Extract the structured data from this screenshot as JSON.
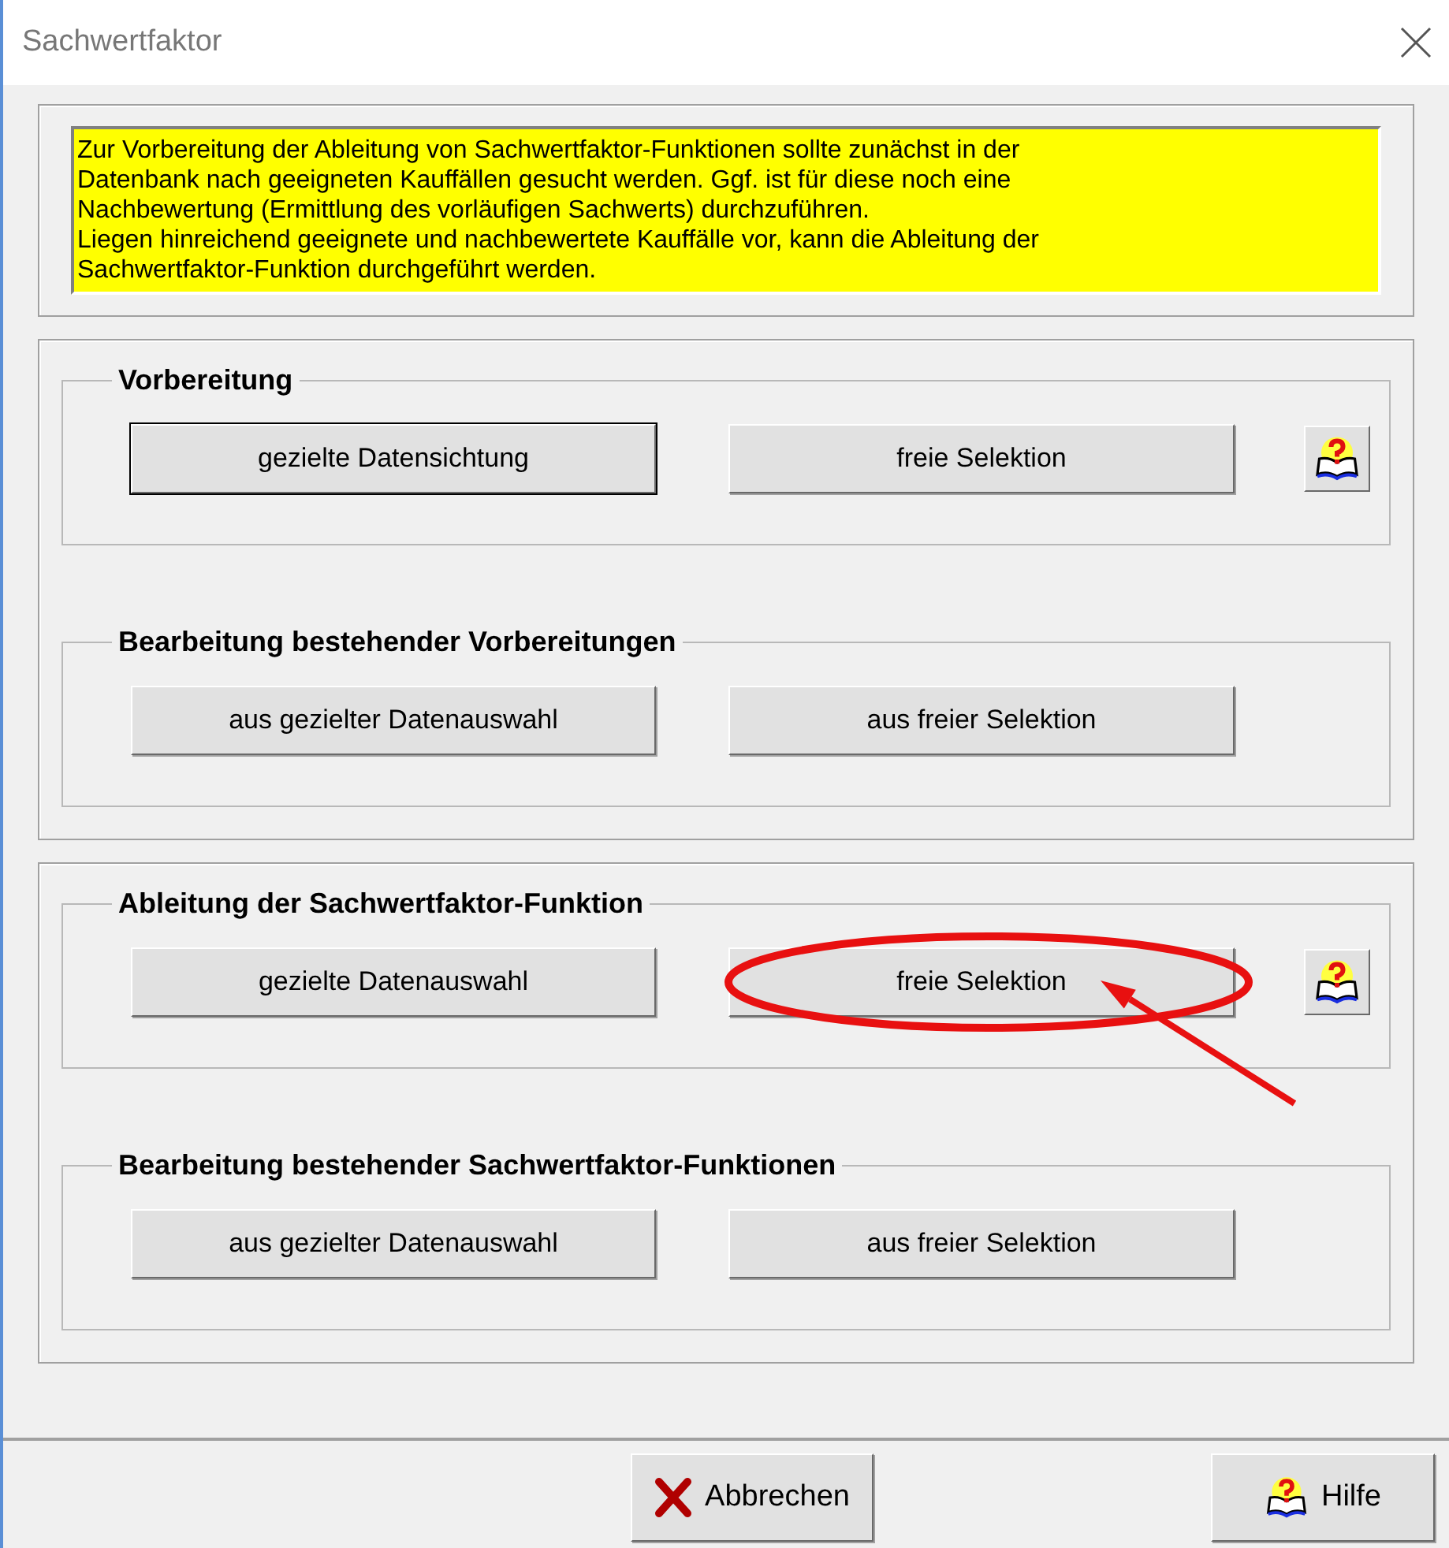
{
  "window": {
    "title": "Sachwertfaktor"
  },
  "info_text": "Zur Vorbereitung der Ableitung von Sachwertfaktor-Funktionen sollte zunächst in der\nDatenbank nach geeigneten Kauffällen gesucht werden. Ggf. ist für diese noch eine\nNachbewertung (Ermittlung des vorläufigen Sachwerts) durchzuführen.\nLiegen hinreichend geeignete und nachbewertete Kauffälle vor, kann die Ableitung der\nSachwertfaktor-Funktion durchgeführt werden.",
  "panels": [
    {
      "groups": [
        {
          "title": "Vorbereitung",
          "help_button": true,
          "buttons": [
            {
              "label": "gezielte Datensichtung",
              "focused": true,
              "circled": false
            },
            {
              "label": "freie Selektion",
              "focused": false,
              "circled": false
            }
          ]
        },
        {
          "title": "Bearbeitung bestehender Vorbereitungen",
          "help_button": false,
          "buttons": [
            {
              "label": "aus gezielter Datenauswahl",
              "focused": false,
              "circled": false
            },
            {
              "label": "aus freier Selektion",
              "focused": false,
              "circled": false
            }
          ]
        }
      ]
    },
    {
      "groups": [
        {
          "title": "Ableitung der Sachwertfaktor-Funktion",
          "help_button": true,
          "buttons": [
            {
              "label": "gezielte Datenauswahl",
              "focused": false,
              "circled": false
            },
            {
              "label": "freie Selektion",
              "focused": false,
              "circled": true
            }
          ]
        },
        {
          "title": "Bearbeitung bestehender Sachwertfaktor-Funktionen",
          "help_button": false,
          "buttons": [
            {
              "label": "aus gezielter Datenauswahl",
              "focused": false,
              "circled": false
            },
            {
              "label": "aus freier Selektion",
              "focused": false,
              "circled": false
            }
          ]
        }
      ]
    }
  ],
  "footer": [
    {
      "kind": "cancel",
      "label": "Abbrechen"
    },
    {
      "kind": "help",
      "label": "Hilfe"
    }
  ]
}
